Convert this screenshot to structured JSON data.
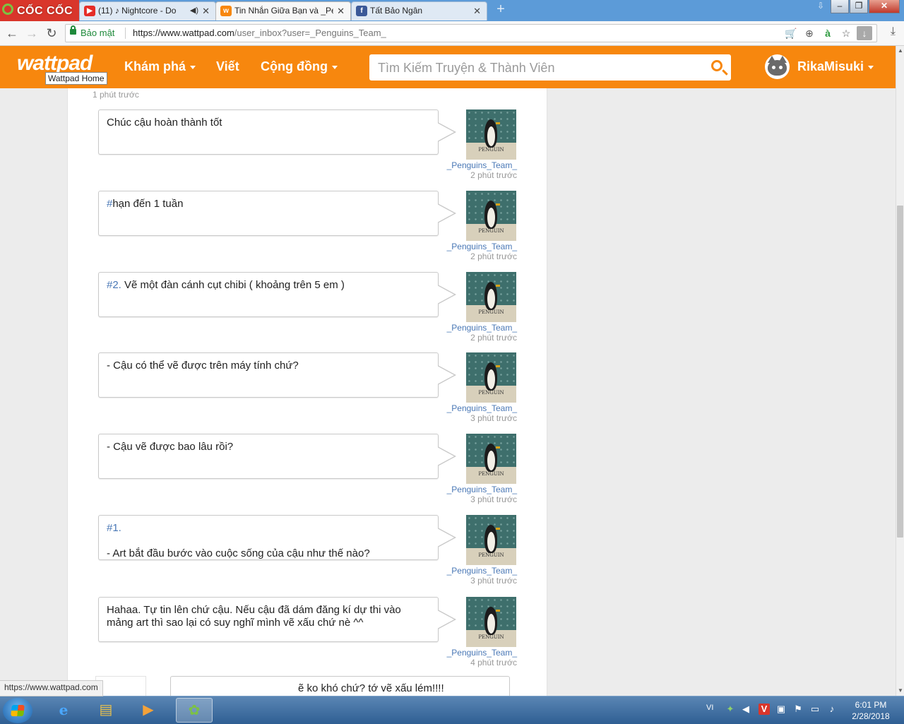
{
  "browser": {
    "brand": "CỐC CỐC",
    "tabs": [
      {
        "label": "(11) ♪ Nightcore - Do",
        "icon": "youtube-icon",
        "playing": true
      },
      {
        "label": "Tin Nhắn Giữa Bạn và _Pen",
        "icon": "wattpad-icon",
        "active": true
      },
      {
        "label": "Tất Bảo Ngân",
        "icon": "facebook-icon"
      }
    ],
    "secure_label": "Bảo mật",
    "url_host": "https://www.wattpad.com",
    "url_path": "/user_inbox?user=_Penguins_Team_"
  },
  "header": {
    "logo": "wattpad",
    "logo_tooltip": "Wattpad Home",
    "nav": {
      "discover": "Khám phá",
      "write": "Viết",
      "community": "Cộng đồng"
    },
    "search_placeholder": "Tìm Kiếm Truyện & Thành Viên",
    "username": "RikaMisuki"
  },
  "conversation": {
    "top_time": "1 phút trước",
    "avatar_caption": "PENGUIN",
    "messages": [
      {
        "tag": "",
        "text": "Chúc cậu hoàn thành tốt",
        "line2": "",
        "sender": "_Penguins_Team_",
        "time": "2 phút trước"
      },
      {
        "tag": "#",
        "text": "hạn đến 1 tuần",
        "line2": "",
        "sender": "_Penguins_Team_",
        "time": "2 phút trước"
      },
      {
        "tag": "#2.",
        "text": " Vẽ một đàn cánh cụt chibi ( khoảng trên 5 em )",
        "line2": "",
        "sender": "_Penguins_Team_",
        "time": "2 phút trước"
      },
      {
        "tag": "",
        "text": "- Cậu có thể vẽ được trên máy tính chứ?",
        "line2": "",
        "sender": "_Penguins_Team_",
        "time": "3 phút trước"
      },
      {
        "tag": "",
        "text": "- Cậu vẽ được bao lâu rồi?",
        "line2": "",
        "sender": "_Penguins_Team_",
        "time": "3 phút trước"
      },
      {
        "tag": "#1.",
        "text": "",
        "line2": "- Art bắt đầu bước vào cuộc sống của cậu như thế nào?",
        "sender": "_Penguins_Team_",
        "time": "3 phút trước"
      },
      {
        "tag": "",
        "text": "Hahaa. Tự tin lên chứ cậu. Nếu cậu đã dám đăng kí dự thi vào mảng art thì sao lại có suy nghĩ mình vẽ xấu chứ nè ^^",
        "line2": "",
        "sender": "_Penguins_Team_",
        "time": "4 phút trước"
      }
    ],
    "reply_partial": "ẽ ko khó chứ? tớ vẽ xấu lém!!!!"
  },
  "status_url": "https://www.wattpad.com",
  "taskbar": {
    "lang": "VI",
    "time": "6:01 PM",
    "date": "2/28/2018"
  },
  "colors": {
    "wattpad_orange": "#f7870e",
    "link_blue": "#4a78b6"
  }
}
